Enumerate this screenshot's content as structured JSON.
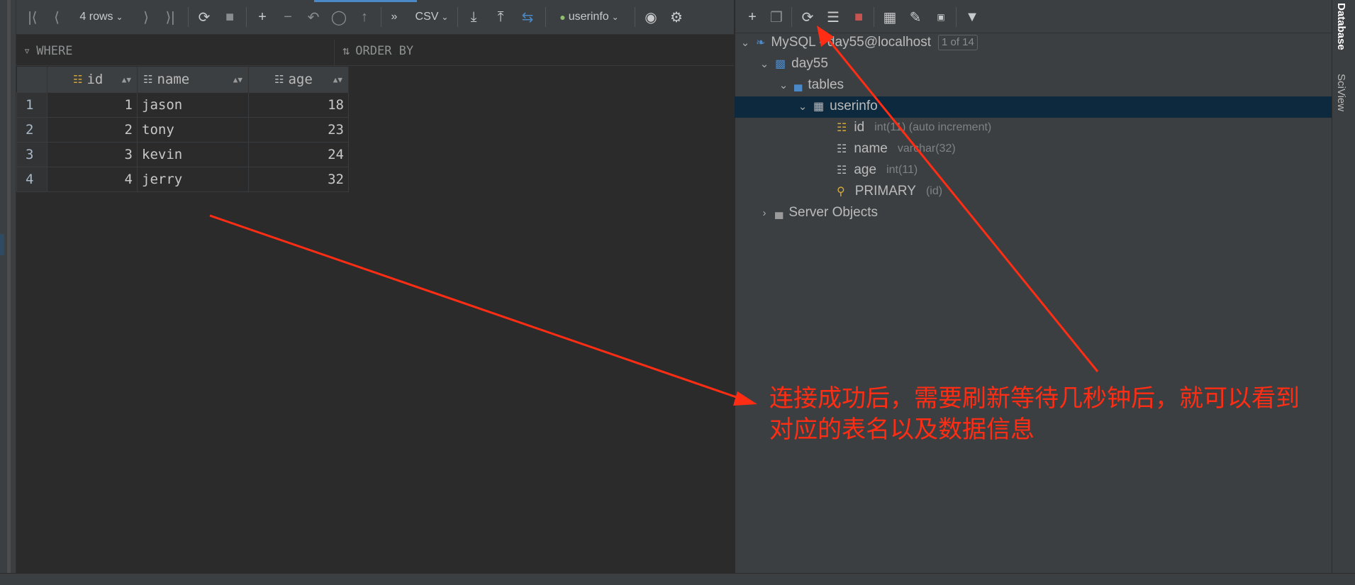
{
  "grid_toolbar": {
    "rows_label": "4 rows",
    "export_format": "CSV",
    "table_selector": "userinfo"
  },
  "filter_bar": {
    "where_label": "WHERE",
    "order_by_label": "ORDER BY"
  },
  "table": {
    "columns": [
      "id",
      "name",
      "age"
    ],
    "rows": [
      {
        "num": "1",
        "id": "1",
        "name": "jason",
        "age": "18"
      },
      {
        "num": "2",
        "id": "2",
        "name": "tony",
        "age": "23"
      },
      {
        "num": "3",
        "id": "3",
        "name": "kevin",
        "age": "24"
      },
      {
        "num": "4",
        "id": "4",
        "name": "jerry",
        "age": "32"
      }
    ]
  },
  "tree": {
    "datasource_label": "MySQL - day55@localhost",
    "datasource_badge": "1 of 14",
    "schema_label": "day55",
    "tables_label": "tables",
    "table_label": "userinfo",
    "columns": [
      {
        "name": "id",
        "type": "int(11) (auto increment)"
      },
      {
        "name": "name",
        "type": "varchar(32)"
      },
      {
        "name": "age",
        "type": "int(11)"
      }
    ],
    "key": {
      "name": "PRIMARY",
      "detail": "(id)"
    },
    "server_objects_label": "Server Objects"
  },
  "side_tabs": {
    "database": "Database",
    "sciview": "SciView"
  },
  "annotation": {
    "line1": "连接成功后，需要刷新等待几秒钟后，就可以看到",
    "line2": "对应的表名以及数据信息",
    "color": "#ff2d14"
  },
  "colors": {
    "accent": "#4a88c7",
    "selection": "#0d293e",
    "stop": "#c75450"
  }
}
